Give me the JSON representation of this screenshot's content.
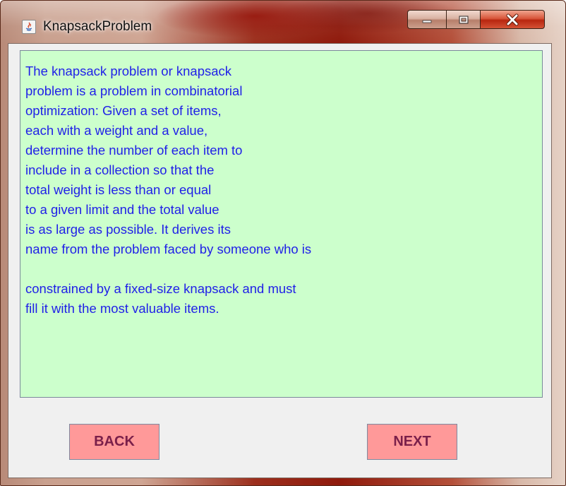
{
  "window": {
    "title": "KnapsackProblem",
    "controls": {
      "minimize_icon": "minimize-icon",
      "maximize_icon": "maximize-icon",
      "close_icon": "close-icon",
      "close_label": "X"
    }
  },
  "panel": {
    "lines": [
      "The knapsack problem or knapsack",
      "problem is a problem in combinatorial",
      "optimization: Given a set of items,",
      "each with a weight and a value,",
      "determine the number of each item to",
      "include in a collection so that the",
      "total weight is less than or equal",
      "to a given limit and the total value",
      "is as large as possible. It derives its",
      "name from the problem faced by someone who is",
      "",
      "constrained by a fixed-size knapsack and must",
      "fill it with the most valuable items."
    ]
  },
  "buttons": {
    "back_label": "BACK",
    "next_label": "NEXT"
  },
  "colors": {
    "panel_background": "#ccffcc",
    "text": "#1f1fe8",
    "button_background": "#ff9999",
    "button_text": "#7a1f4a"
  }
}
